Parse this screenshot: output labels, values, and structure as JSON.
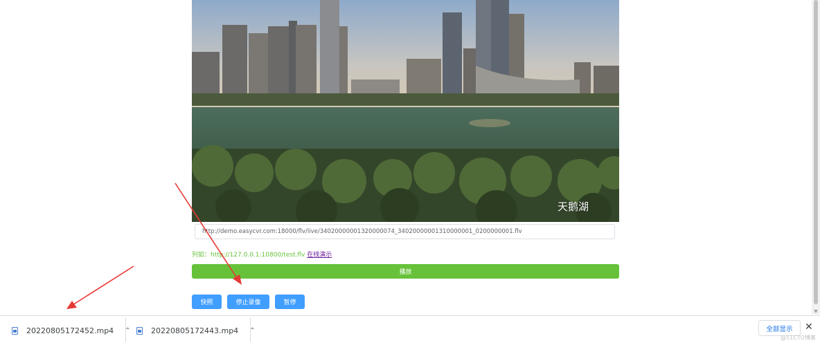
{
  "video": {
    "watermark": "天鹅湖"
  },
  "url_input": {
    "value": "http://demo.easycvr.com:18000/flv/live/34020000001320000074_34020000001310000001_0200000001.flv"
  },
  "hint": {
    "prefix": "列如：http://127.0.0.1:10800/test.flv",
    "link": "在线演示"
  },
  "buttons": {
    "play": "播放",
    "snapshot": "快照",
    "stop_record": "停止录像",
    "pause": "暂停"
  },
  "downloads": {
    "items": [
      {
        "name": "20220805172452.mp4"
      },
      {
        "name": "20220805172443.mp4"
      }
    ],
    "show_all": "全部显示"
  },
  "credit": "@51CTO博客",
  "colors": {
    "play_button": "#67c23a",
    "action_button": "#409eff",
    "annotation_arrow": "#e53935",
    "hint_text": "#67c23a"
  },
  "icons": {
    "file": "file-icon",
    "chevron": "chevron-up-icon",
    "close": "close-icon"
  }
}
